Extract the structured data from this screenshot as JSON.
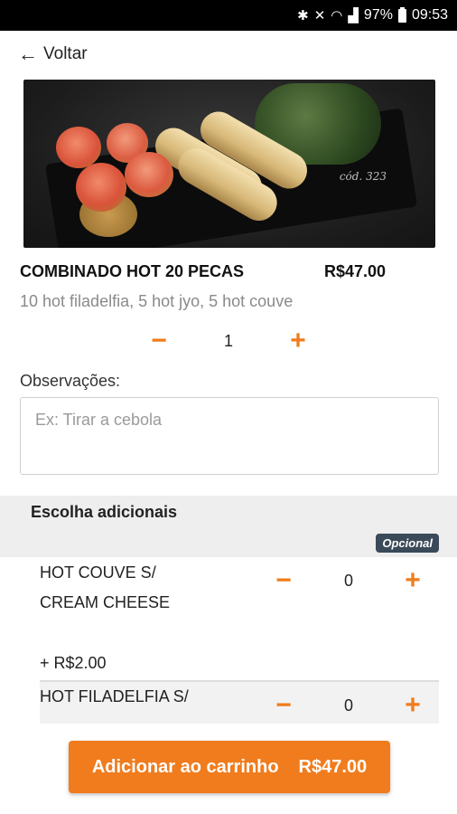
{
  "status_bar": {
    "battery": "97%",
    "time": "09:53"
  },
  "header": {
    "back_label": "Voltar"
  },
  "product": {
    "image_code": "cód. 323",
    "name": "COMBINADO HOT 20 PECAS",
    "price": "R$47.00",
    "description": "10 hot filadelfia, 5 hot jyo, 5 hot couve",
    "quantity": "1"
  },
  "observations": {
    "label": "Observações:",
    "placeholder": "Ex: Tirar a cebola",
    "value": ""
  },
  "addons": {
    "title": "Escolha adicionais",
    "badge": "Opcional",
    "items": [
      {
        "name_line1": "HOT COUVE S/",
        "name_line2": "CREAM CHEESE",
        "price": "+ R$2.00",
        "quantity": "0"
      },
      {
        "name_line1": "HOT FILADELFIA S/",
        "quantity": "0"
      }
    ]
  },
  "cart_button": {
    "label": "Adicionar ao carrinho",
    "total": "R$47.00"
  },
  "colors": {
    "accent": "#f07c1d",
    "badge": "#3b4a58"
  }
}
